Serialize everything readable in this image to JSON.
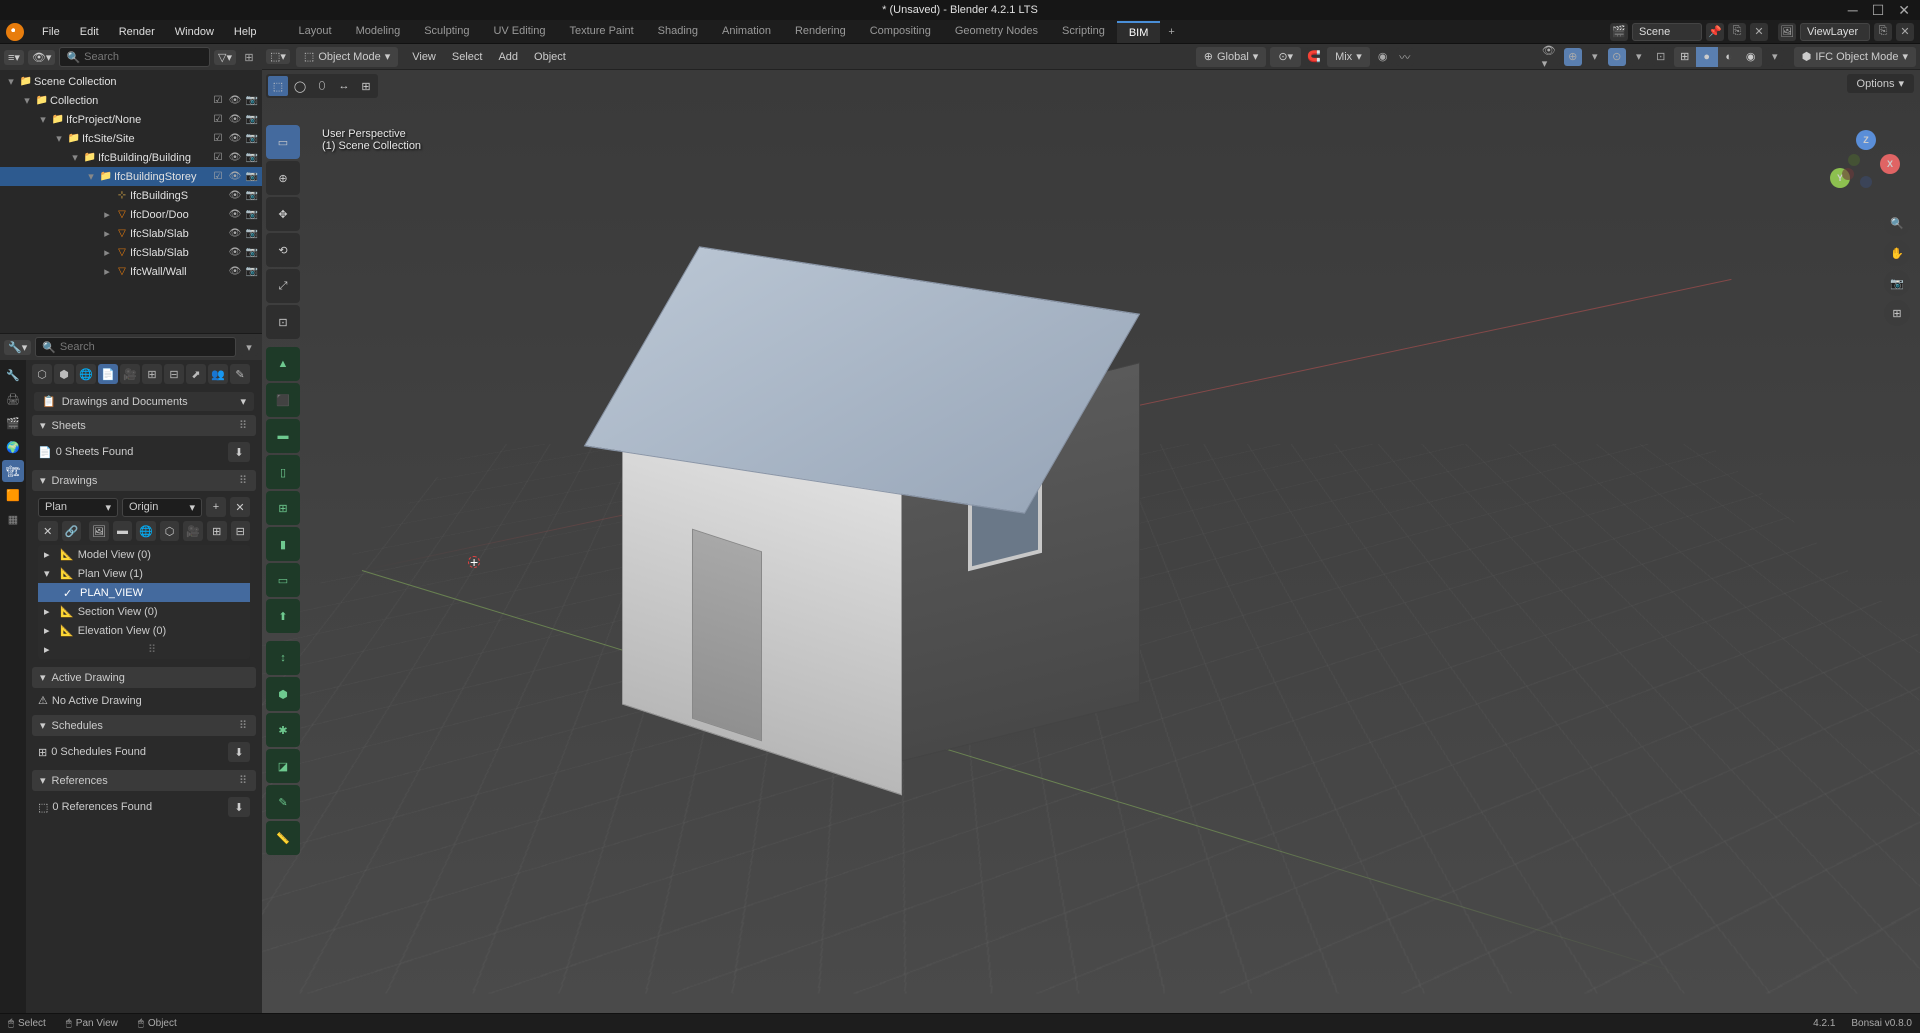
{
  "title": "* (Unsaved) - Blender 4.2.1 LTS",
  "menus": [
    "File",
    "Edit",
    "Render",
    "Window",
    "Help"
  ],
  "workspaces": [
    "Layout",
    "Modeling",
    "Sculpting",
    "UV Editing",
    "Texture Paint",
    "Shading",
    "Animation",
    "Rendering",
    "Compositing",
    "Geometry Nodes",
    "Scripting",
    "BIM"
  ],
  "active_workspace": "BIM",
  "scene_label": "Scene",
  "layer_label": "ViewLayer",
  "outliner": {
    "search_placeholder": "Search",
    "tree": [
      {
        "depth": 0,
        "toggle": "▾",
        "icon": "collection",
        "label": "Scene Collection",
        "ctrls": []
      },
      {
        "depth": 1,
        "toggle": "▾",
        "icon": "collection",
        "label": "Collection",
        "ctrls": [
          "chk",
          "eye",
          "cam"
        ]
      },
      {
        "depth": 2,
        "toggle": "▾",
        "icon": "collection",
        "label": "IfcProject/None",
        "ctrls": [
          "chk",
          "eye",
          "cam"
        ]
      },
      {
        "depth": 3,
        "toggle": "▾",
        "icon": "collection",
        "label": "IfcSite/Site",
        "ctrls": [
          "chk",
          "eye",
          "cam"
        ]
      },
      {
        "depth": 4,
        "toggle": "▾",
        "icon": "collection",
        "label": "IfcBuilding/Building",
        "ctrls": [
          "chk",
          "eye",
          "cam"
        ]
      },
      {
        "depth": 5,
        "toggle": "▾",
        "icon": "collection",
        "label": "IfcBuildingStorey",
        "ctrls": [
          "chk",
          "eye",
          "cam"
        ],
        "active": true
      },
      {
        "depth": 6,
        "toggle": "",
        "icon": "empty",
        "label": "IfcBuildingS",
        "ctrls": [
          "eye",
          "cam"
        ]
      },
      {
        "depth": 6,
        "toggle": "▸",
        "icon": "mesh",
        "label": "IfcDoor/Doo",
        "ctrls": [
          "eye",
          "cam"
        ]
      },
      {
        "depth": 6,
        "toggle": "▸",
        "icon": "mesh",
        "label": "IfcSlab/Slab",
        "ctrls": [
          "eye",
          "cam"
        ]
      },
      {
        "depth": 6,
        "toggle": "▸",
        "icon": "mesh",
        "label": "IfcSlab/Slab",
        "ctrls": [
          "eye",
          "cam"
        ]
      },
      {
        "depth": 6,
        "toggle": "▸",
        "icon": "mesh",
        "label": "IfcWall/Wall",
        "ctrls": [
          "eye",
          "cam"
        ]
      }
    ]
  },
  "props": {
    "search_placeholder": "Search",
    "selector": "Drawings and Documents",
    "sheets": {
      "title": "Sheets",
      "msg": "0 Sheets Found"
    },
    "drawings": {
      "title": "Drawings",
      "type": "Plan",
      "origin": "Origin",
      "items": [
        {
          "label": "Model View (0)",
          "expanded": false
        },
        {
          "label": "Plan View (1)",
          "expanded": true,
          "children": [
            {
              "label": "PLAN_VIEW",
              "checked": true,
              "selected": true
            }
          ]
        },
        {
          "label": "Section View (0)",
          "expanded": false
        },
        {
          "label": "Elevation View (0)",
          "expanded": false
        }
      ]
    },
    "active_drawing": {
      "title": "Active Drawing",
      "msg": "No Active Drawing"
    },
    "schedules": {
      "title": "Schedules",
      "msg": "0 Schedules Found"
    },
    "references": {
      "title": "References",
      "msg": "0 References Found"
    }
  },
  "viewport": {
    "mode": "Object Mode",
    "menus": [
      "View",
      "Select",
      "Add",
      "Object"
    ],
    "orient": "Global",
    "snap": "Mix",
    "ifc_mode": "IFC Object Mode",
    "info_line1": "User Perspective",
    "info_line2": "(1) Scene Collection",
    "options": "Options"
  },
  "status": {
    "select": "Select",
    "pan": "Pan View",
    "object": "Object",
    "version": "4.2.1",
    "bonsai": "Bonsai v0.8.0"
  }
}
